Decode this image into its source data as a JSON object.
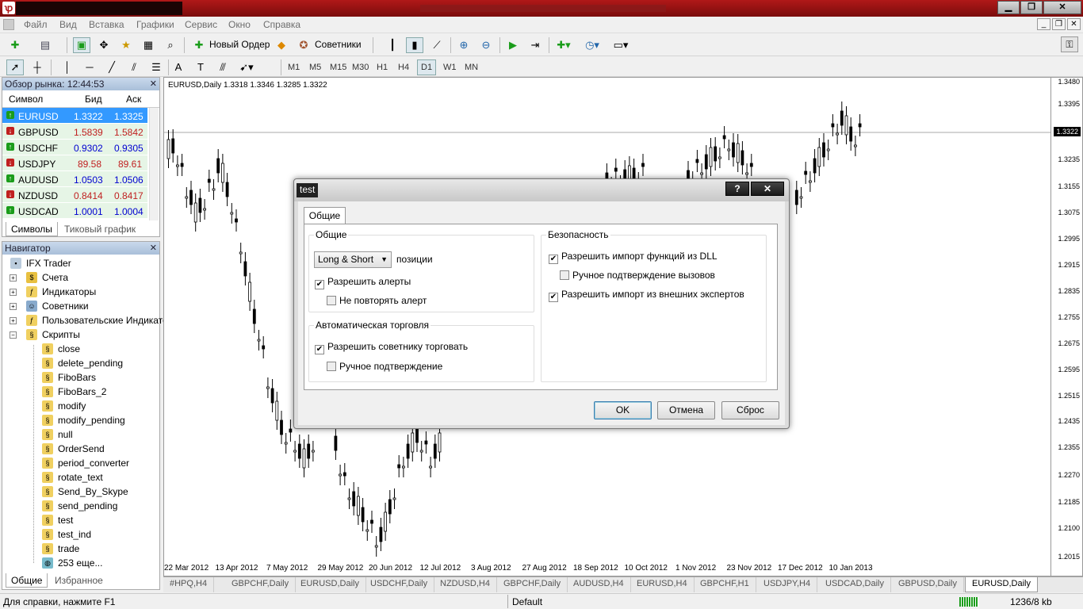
{
  "titlebar": {
    "min": "▁",
    "max": "❐",
    "close": "✕"
  },
  "menu": [
    "Файл",
    "Вид",
    "Вставка",
    "Графики",
    "Сервис",
    "Окно",
    "Справка"
  ],
  "toolbar": {
    "new_order": "Новый Ордер",
    "experts": "Советники"
  },
  "timeframes": [
    "M1",
    "M5",
    "M15",
    "M30",
    "H1",
    "H4",
    "D1",
    "W1",
    "MN"
  ],
  "active_timeframe": "D1",
  "market_watch": {
    "title": "Обзор рынка: 12:44:53",
    "cols": [
      "Символ",
      "Бид",
      "Аск"
    ],
    "rows": [
      {
        "symbol": "EURUSD",
        "bid": "1.3322",
        "ask": "1.3325",
        "dir": "up"
      },
      {
        "symbol": "GBPUSD",
        "bid": "1.5839",
        "ask": "1.5842",
        "dir": "down"
      },
      {
        "symbol": "USDCHF",
        "bid": "0.9302",
        "ask": "0.9305",
        "dir": "up"
      },
      {
        "symbol": "USDJPY",
        "bid": "89.58",
        "ask": "89.61",
        "dir": "down"
      },
      {
        "symbol": "AUDUSD",
        "bid": "1.0503",
        "ask": "1.0506",
        "dir": "up"
      },
      {
        "symbol": "NZDUSD",
        "bid": "0.8414",
        "ask": "0.8417",
        "dir": "down"
      },
      {
        "symbol": "USDCAD",
        "bid": "1.0001",
        "ask": "1.0004",
        "dir": "up"
      }
    ],
    "tabs": [
      "Символы",
      "Тиковый график"
    ]
  },
  "navigator": {
    "title": "Навигатор",
    "root": "IFX Trader",
    "folders": [
      "Счета",
      "Индикаторы",
      "Советники",
      "Пользовательские Индикаторы",
      "Скрипты"
    ],
    "scripts": [
      "close",
      "delete_pending",
      "FiboBars",
      "FiboBars_2",
      "modify",
      "modify_pending",
      "null",
      "OrderSend",
      "period_converter",
      "rotate_text",
      "Send_By_Skype",
      "send_pending",
      "test",
      "test_ind",
      "trade",
      "253 еще..."
    ],
    "tabs": [
      "Общие",
      "Избранное"
    ]
  },
  "chart": {
    "header": "EURUSD,Daily  1.3318 1.3346 1.3285 1.3322",
    "prices": [
      "1.3480",
      "1.3395",
      "1.3322",
      "1.3235",
      "1.3155",
      "1.3075",
      "1.2995",
      "1.2915",
      "1.2835",
      "1.2755",
      "1.2675",
      "1.2595",
      "1.2515",
      "1.2435",
      "1.2355",
      "1.2270",
      "1.2185",
      "1.2100",
      "1.2015"
    ],
    "dates": [
      "22 Mar 2012",
      "13 Apr 2012",
      "7 May 2012",
      "29 May 2012",
      "20 Jun 2012",
      "12 Jul 2012",
      "3 Aug 2012",
      "27 Aug 2012",
      "18 Sep 2012",
      "10 Oct 2012",
      "1 Nov 2012",
      "23 Nov 2012",
      "17 Dec 2012",
      "10 Jan 2013"
    ]
  },
  "chart_tabs": [
    "#HPQ,H4",
    "GBPCHF,Daily",
    "EURUSD,Daily",
    "USDCHF,Daily",
    "NZDUSD,H4",
    "GBPCHF,Daily",
    "AUDUSD,H4",
    "EURUSD,H4",
    "GBPCHF,H1",
    "USDJPY,H4",
    "USDCAD,Daily",
    "GBPUSD,Daily",
    "EURUSD,Daily"
  ],
  "status": {
    "help": "Для справки, нажмите F1",
    "profile": "Default",
    "traffic": "1236/8 kb"
  },
  "dialog": {
    "title": "test",
    "help": "?",
    "close": "✕",
    "tab": "Общие",
    "general_group": "Общие",
    "positions_value": "Long & Short",
    "positions_label": "позиции",
    "allow_alerts": "Разрешить алерты",
    "no_repeat_alert": "Не повторять алерт",
    "auto_group": "Автоматическая торговля",
    "allow_trade": "Разрешить советнику торговать",
    "manual_confirm": "Ручное подтверждение",
    "security_group": "Безопасность",
    "allow_dll": "Разрешить импорт функций из DLL",
    "manual_calls": "Ручное подтверждение вызовов",
    "allow_external": "Разрешить импорт из внешних экспертов",
    "ok": "OK",
    "cancel": "Отмена",
    "reset": "Сброс"
  },
  "colors": {
    "up": "#1a9c1a",
    "down": "#c02020",
    "selected_row": "#3399ff",
    "bid_blue": "#0000d0"
  }
}
